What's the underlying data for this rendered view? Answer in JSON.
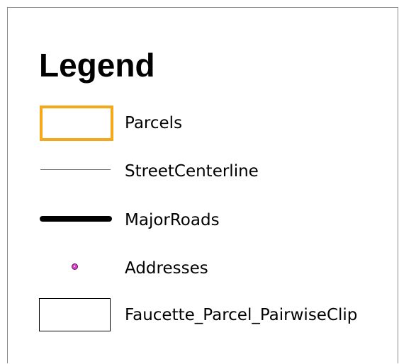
{
  "legend": {
    "title": "Legend",
    "items": [
      {
        "label": "Parcels",
        "symbol": "polygon-outline",
        "color": "#f6a81b"
      },
      {
        "label": "StreetCenterline",
        "symbol": "thin-line",
        "color": "#6e6e6e"
      },
      {
        "label": "MajorRoads",
        "symbol": "thick-line",
        "color": "#000000"
      },
      {
        "label": "Addresses",
        "symbol": "point-marker",
        "color": "#e33bd1"
      },
      {
        "label": "Faucette_Parcel_PairwiseClip",
        "symbol": "polygon-outline",
        "color": "#000000"
      }
    ]
  }
}
